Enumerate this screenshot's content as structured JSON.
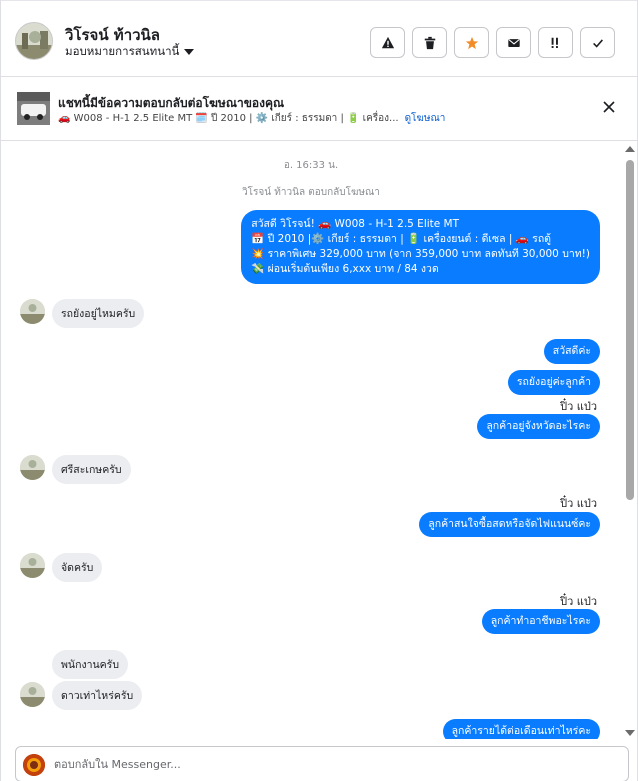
{
  "header": {
    "contact_name": "วิโรจน์ ท้าวนิล",
    "assign_label": "มอบหมายการสนทนานี้",
    "actions": [
      {
        "name": "report-button",
        "icon": "warning-icon"
      },
      {
        "name": "delete-button",
        "icon": "trash-icon"
      },
      {
        "name": "star-button",
        "icon": "star-icon"
      },
      {
        "name": "mark-unread-button",
        "icon": "envelope-icon"
      },
      {
        "name": "follow-up-button",
        "icon": "flag-icon"
      },
      {
        "name": "done-button",
        "icon": "check-icon"
      }
    ]
  },
  "ad": {
    "title": "แชทนี้มีข้อความตอบกลับต่อโฆษณาของคุณ",
    "description": "🚗 W008 - H-1 2.5 Elite MT 🗓️ ปี 2010 | ⚙️ เกียร์ : ธรรมดา | 🔋 เครื่อง...",
    "link": "ดูโฆษณา"
  },
  "chat": {
    "timestamp": "อ. 16:33 น.",
    "system_note": "วิโรจน์ ท้าวนิล ตอบกลับโฆษณา",
    "ad_reply_lines": [
      "สวัสดี วิโรจน์! 🚗 W008 - H-1 2.5 Elite MT",
      "📅 ปี 2010 |⚙️ เกียร์ : ธรรมดา | 🔋 เครื่องยนต์ : ดีเซล | 🚗 รถตู้",
      "💥 ราคาพิเศษ 329,000 บาท (จาก 359,000 บาท ลดทันที 30,000 บาท!)",
      "💸 ผ่อนเริ่มต้นเพียง 6,xxx บาท / 84 งวด"
    ],
    "msg_in_1": "รถยังอยู่ไหมครับ",
    "msg_out_1": "สวัสดีค่ะ",
    "msg_out_2": "รถยังอยู่ค่ะลูกค้า",
    "sender_1": "ปิ๋ว แป่ว",
    "msg_out_3": "ลูกค้าอยู่จังหวัดอะไรคะ",
    "msg_in_2": "ศรีสะเกษครับ",
    "sender_2": "ปิ๋ว แป่ว",
    "msg_out_4": "ลูกค้าสนใจซื้อสดหรือจัดไฟแนนซ์คะ",
    "msg_in_3": "จัดครับ",
    "sender_3": "ปิ๋ว แป่ว",
    "msg_out_5": "ลูกค้าทำอาชีพอะไรคะ",
    "msg_in_4": "พนักงานครับ",
    "msg_in_5": "ดาวเท่าไหร่ครับ",
    "msg_out_6": "ลูกค้ารายได้ต่อเดือนเท่าไหร่คะ"
  },
  "composer": {
    "placeholder": "ตอบกลับใน Messenger..."
  },
  "colors": {
    "accent": "#0a7cff",
    "incoming_bubble": "#ebedf0",
    "link": "#0a5fd3"
  }
}
